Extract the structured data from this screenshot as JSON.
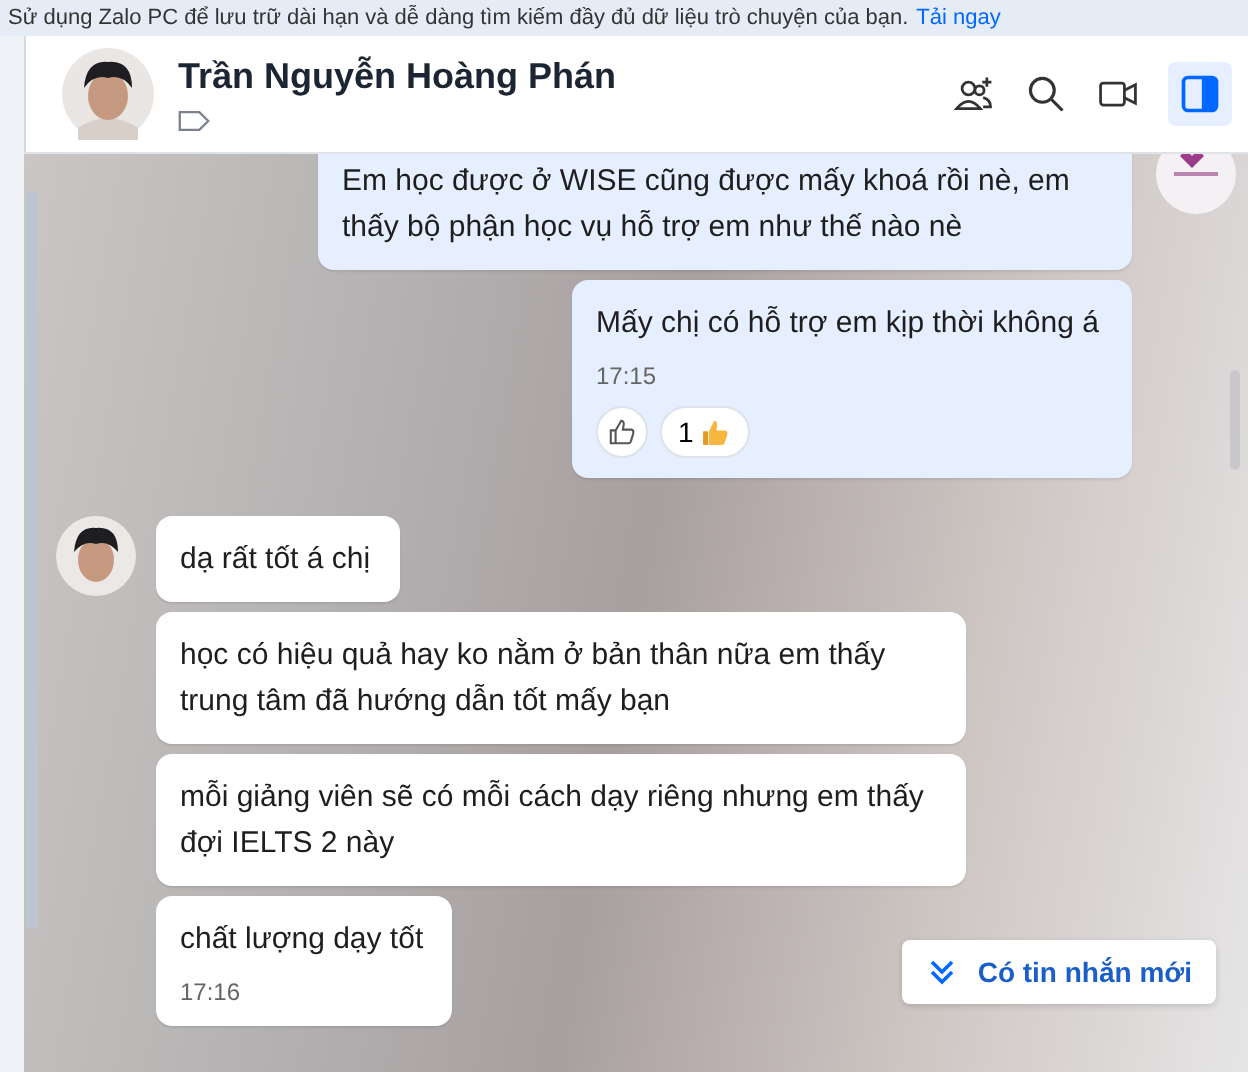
{
  "banner": {
    "text": "Sử dụng Zalo PC để lưu trữ dài hạn và dễ dàng tìm kiếm đầy đủ dữ liệu trò chuyện của bạn.",
    "link": "Tải ngay"
  },
  "header": {
    "name": "Trần Nguyễn Hoàng Phán",
    "panel_open": true
  },
  "messages": [
    {
      "kind": "outgoing",
      "show_avatar": true,
      "clipped": true,
      "text": "Em học được ở WISE cũng được mấy khoá rồi nè, em thấy bộ phận học vụ hỗ trợ em như thế nào nè"
    },
    {
      "kind": "outgoing",
      "show_avatar": false,
      "clipped": false,
      "text": "Mấy chị có hỗ trợ em kịp thời không á",
      "time": "17:15",
      "reaction_count": "1"
    },
    {
      "kind": "incoming",
      "show_avatar": true,
      "clipped": false,
      "text": "dạ rất tốt á chị"
    },
    {
      "kind": "incoming",
      "show_avatar": false,
      "clipped": false,
      "text": "học có hiệu quả hay ko nằm ở bản thân nữa em thấy trung tâm đã hướng dẫn tốt mấy bạn"
    },
    {
      "kind": "incoming",
      "show_avatar": false,
      "clipped": false,
      "text": "mỗi giảng viên sẽ có mỗi cách dạy riêng nhưng em thấy đợi IELTS 2 này"
    },
    {
      "kind": "incoming",
      "show_avatar": false,
      "clipped": false,
      "text": "chất lượng dạy tốt",
      "time": "17:16"
    }
  ],
  "new_message_button": {
    "label": "Có tin nhắn mới"
  }
}
